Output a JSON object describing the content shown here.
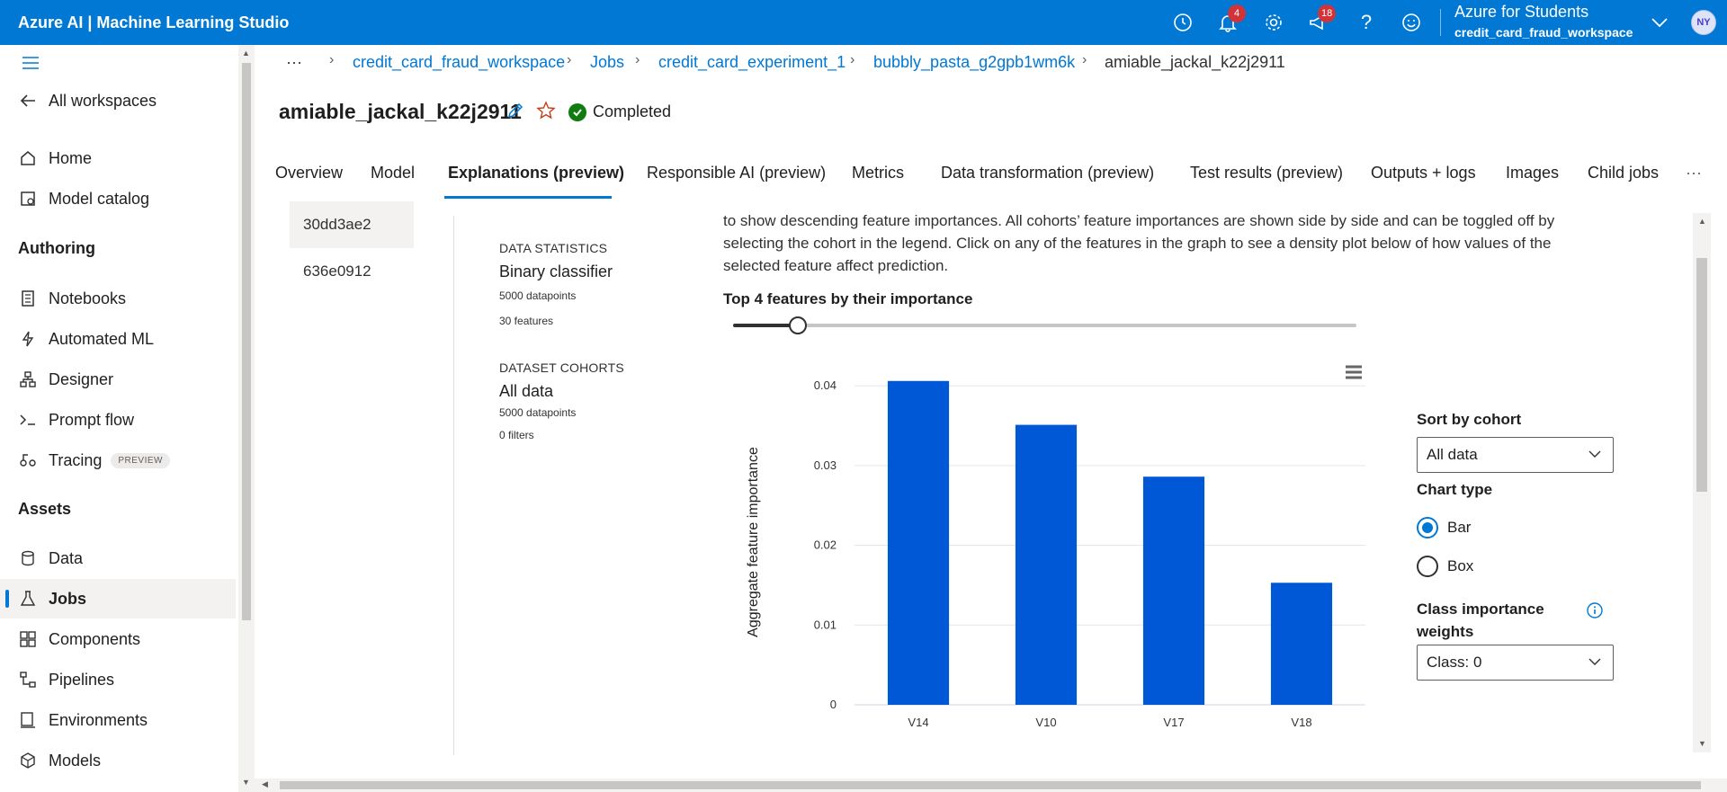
{
  "app": {
    "title": "Azure AI | Machine Learning Studio"
  },
  "topbar": {
    "notifications_count": "4",
    "feedback_count": "18",
    "account_name": "Azure for Students",
    "account_workspace": "credit_card_fraud_workspace",
    "avatar_initials": "NY",
    "accent_color": "#0078d4"
  },
  "sidebar": {
    "back_label": "All workspaces",
    "home": "Home",
    "model_catalog": "Model catalog",
    "authoring_header": "Authoring",
    "notebooks": "Notebooks",
    "automated_ml": "Automated ML",
    "designer": "Designer",
    "prompt_flow": "Prompt flow",
    "tracing": "Tracing",
    "tracing_badge": "PREVIEW",
    "assets_header": "Assets",
    "data": "Data",
    "jobs": "Jobs",
    "components": "Components",
    "pipelines": "Pipelines",
    "environments": "Environments",
    "models": "Models"
  },
  "breadcrumb": {
    "ellipsis": "···",
    "items": [
      "credit_card_fraud_workspace",
      "Jobs",
      "credit_card_experiment_1",
      "bubbly_pasta_g2gpb1wm6k",
      "amiable_jackal_k22j2911"
    ]
  },
  "job": {
    "title": "amiable_jackal_k22j2911",
    "status": "Completed"
  },
  "tabs": [
    "Overview",
    "Model",
    "Explanations (preview)",
    "Responsible AI (preview)",
    "Metrics",
    "Data transformation (preview)",
    "Test results (preview)",
    "Outputs + logs",
    "Images",
    "Child jobs"
  ],
  "tabs_more": "···",
  "runs": [
    "30dd3ae2",
    "636e0912"
  ],
  "stats": {
    "data_statistics_header": "DATA STATISTICS",
    "classifier": "Binary classifier",
    "datapoints": "5000 datapoints",
    "features": "30 features",
    "dataset_cohorts_header": "DATASET COHORTS",
    "cohort_name": "All data",
    "cohort_datapoints": "5000 datapoints",
    "cohort_filters": "0 filters"
  },
  "explanation": {
    "description": "to show descending feature importances. All cohorts’ feature importances are shown side by side and can be toggled off by selecting the cohort in the legend. Click on any of the features in the graph to see a density plot below of how values of the selected feature affect prediction.",
    "top_features_label": "Top 4 features by their importance",
    "slider_value": 4,
    "slider_max": 30
  },
  "controls": {
    "sort_by_label": "Sort by cohort",
    "sort_by_value": "All data",
    "chart_type_label": "Chart type",
    "chart_type_options": [
      "Bar",
      "Box"
    ],
    "chart_type_selected": "Bar",
    "class_weights_label_1": "Class importance",
    "class_weights_label_2": "weights",
    "class_value": "Class: 0"
  },
  "chart_data": {
    "type": "bar",
    "categories": [
      "V14",
      "V10",
      "V17",
      "V18"
    ],
    "values": [
      0.0406,
      0.0351,
      0.0286,
      0.0153
    ],
    "ylabel": "Aggregate feature importance",
    "xlabel": "",
    "ylim": [
      0,
      0.04
    ],
    "yticks": [
      "0",
      "0.01",
      "0.02",
      "0.03",
      "0.04"
    ],
    "grid": true,
    "bar_color": "#0058d6"
  }
}
